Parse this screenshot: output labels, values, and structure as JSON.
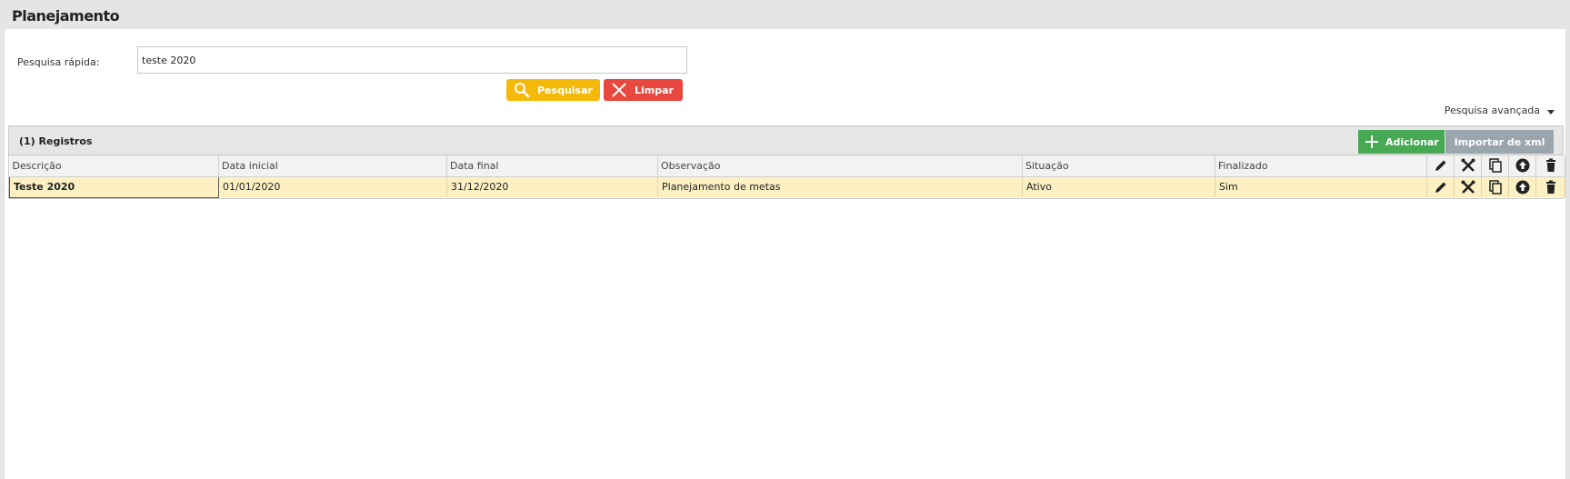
{
  "page": {
    "title": "Planejamento"
  },
  "search": {
    "label": "Pesquisa rápida:",
    "value": "teste 2020",
    "search_button": "Pesquisar",
    "clear_button": "Limpar",
    "advanced_label": "Pesquisa avançada"
  },
  "grid": {
    "count_label": "(1) Registros",
    "add_button": "Adicionar",
    "import_button": "Importar de xml",
    "columns": [
      "Descrição",
      "Data inicial",
      "Data final",
      "Observação",
      "Situação",
      "Finalizado"
    ],
    "rows": [
      {
        "descricao": "Teste 2020",
        "data_inicial": "01/01/2020",
        "data_final": "31/12/2020",
        "observacao": "Planejamento de metas",
        "situacao": "Ativo",
        "finalizado": "Sim"
      }
    ],
    "action_icons": [
      "pencil-icon",
      "tools-icon",
      "copy-icon",
      "arrow-up-circle-icon",
      "trash-icon"
    ]
  },
  "colors": {
    "search_btn": "#f5b90a",
    "clear_btn": "#e9483e",
    "add_btn": "#48a955",
    "import_btn": "#9aa5ae",
    "row_selected": "#fdf1c4"
  }
}
